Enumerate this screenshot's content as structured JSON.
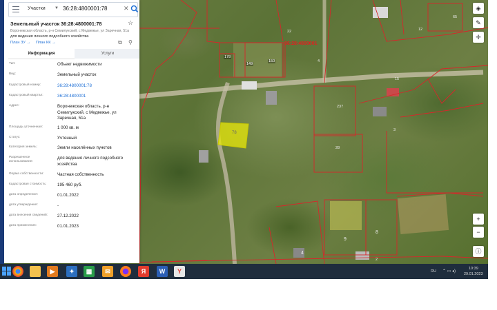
{
  "search": {
    "category": "Участки",
    "value": "36:28:4800001:78"
  },
  "parcel": {
    "title": "Земельный участок 36:28:4800001:78",
    "address": "Воронежская область, р-н Семилукский, с Медвежье, ул Заречная, 51а",
    "usage": "для ведения личного подсобного хозяйства",
    "plan_zu": "План ЗУ →",
    "plan_kk": "План КК →"
  },
  "tabs": {
    "info": "Информация",
    "services": "Услуги"
  },
  "rows": [
    {
      "key": "Тип:",
      "value": "Объект недвижимости"
    },
    {
      "key": "Вид:",
      "value": "Земельный участок"
    },
    {
      "key": "Кадастровый номер:",
      "value": "36:28:4800001:78"
    },
    {
      "key": "Кадастровый квартал:",
      "value": "36:28:4800001"
    },
    {
      "key": "Адрес:",
      "value": "Воронежская область, р-н Семилукский, с Медвежье, ул Заречная, 51а"
    },
    {
      "key": "Площадь уточненная:",
      "value": "1 000 кв. м"
    },
    {
      "key": "Статус:",
      "value": "Учтенный"
    },
    {
      "key": "Категория земель:",
      "value": "Земли населённых пунктов"
    },
    {
      "key": "Разрешенное использование:",
      "value": "для ведения личного подсобного хозяйства"
    },
    {
      "key": "Форма собственности:",
      "value": "Частная собственность"
    },
    {
      "key": "Кадастровая стоимость:",
      "value": "195 460 руб."
    },
    {
      "key": "дата определения:",
      "value": "01.01.2022"
    },
    {
      "key": "дата утверждения:",
      "value": "-"
    },
    {
      "key": "дата внесения сведений:",
      "value": "27.12.2022"
    },
    {
      "key": "дата применения:",
      "value": "01.01.2023"
    }
  ],
  "map_labels": {
    "quarter": "36:28:4800001",
    "selected": "78",
    "parcels": [
      "22",
      "178",
      "149",
      "150",
      "4",
      "12",
      "65",
      "237",
      "28",
      "9",
      "8",
      "4",
      "2",
      "3",
      "15"
    ]
  },
  "tray": {
    "lang": "RU",
    "time": "10:39",
    "date": "29.01.2023"
  },
  "colors": {
    "boundary": "#d8262a",
    "selected_fill": "#e8e80a",
    "link": "#1d6fd6",
    "taskbar": "#1f2d3d"
  }
}
